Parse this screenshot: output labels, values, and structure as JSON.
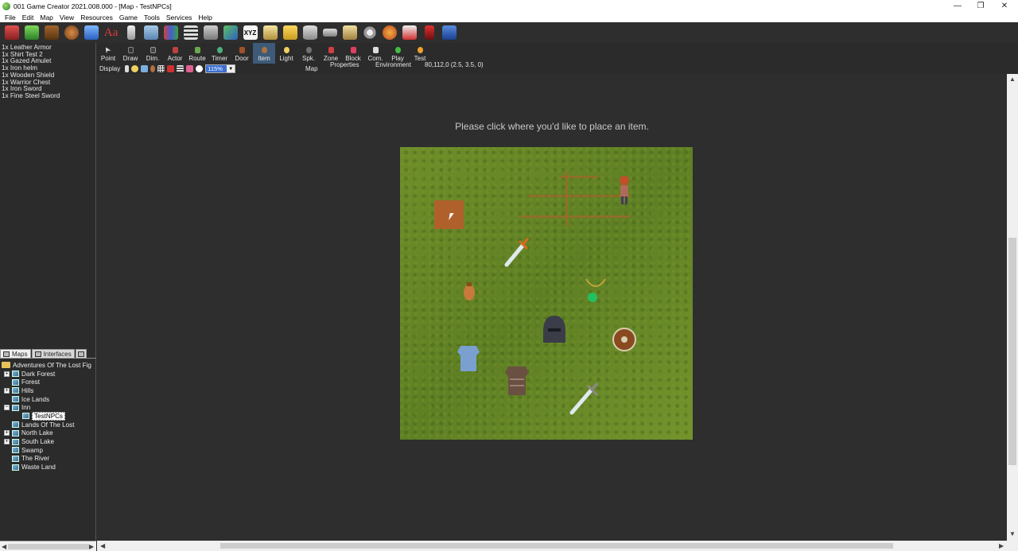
{
  "window": {
    "title": "001 Game Creator 2021.008.000 - [Map - TestNPCs]",
    "controls": [
      "—",
      "❐",
      "✕"
    ]
  },
  "menu": [
    "File",
    "Edit",
    "Map",
    "View",
    "Resources",
    "Game",
    "Tools",
    "Services",
    "Help"
  ],
  "toolbar_icons": [
    "character-icon",
    "tree-icon",
    "door-icon",
    "bag-icon",
    "music-icon",
    "font-icon",
    "figure-icon",
    "book-icon",
    "group-icon",
    "list-icon",
    "robot-icon",
    "chart-icon",
    "xyz-icon",
    "window-icon",
    "folder-icon",
    "database-icon",
    "controller-icon",
    "keyboard-icon",
    "gear-icon",
    "wrench-icon",
    "video-icon",
    "film-icon",
    "save-icon"
  ],
  "inventory": [
    "1x Leather Armor",
    "1x Shirt Test 2",
    "1x Gazed Amulet",
    "1x Iron helm",
    "1x Wooden Shield",
    "1x Warrior Chest",
    "1x Iron Sword",
    "1x Fine Steel Sword"
  ],
  "panel_tabs": [
    {
      "label": "Maps"
    },
    {
      "label": "Interfaces"
    }
  ],
  "tree": {
    "root": "Adventures Of The Lost Fig",
    "items": [
      {
        "label": "Dark Forest",
        "expandable": true
      },
      {
        "label": "Forest",
        "expandable": false
      },
      {
        "label": "Hills",
        "expandable": true
      },
      {
        "label": "Ice Lands",
        "expandable": false
      },
      {
        "label": "Inn",
        "expandable": true,
        "expanded": true
      },
      {
        "label": "TestNPCs",
        "child": true,
        "selected": true
      },
      {
        "label": "Lands Of The Lost",
        "expandable": false
      },
      {
        "label": "North Lake",
        "expandable": true
      },
      {
        "label": "South Lake",
        "expandable": true
      },
      {
        "label": "Swamp",
        "expandable": false
      },
      {
        "label": "The River",
        "expandable": false
      },
      {
        "label": "Waste Land",
        "expandable": false
      }
    ]
  },
  "edit_tools": [
    {
      "label": "Point",
      "color": "#dddddd"
    },
    {
      "label": "Draw",
      "color": "#333333"
    },
    {
      "label": "Dim.",
      "color": "#444444"
    },
    {
      "label": "Actor",
      "color": "#c04040"
    },
    {
      "label": "Route",
      "color": "#6aa84f"
    },
    {
      "label": "Timer",
      "color": "#4caf7a"
    },
    {
      "label": "Door",
      "color": "#a0522d"
    },
    {
      "label": "Item",
      "color": "#b07040",
      "active": true
    },
    {
      "label": "Light",
      "color": "#f0d060"
    },
    {
      "label": "Spk.",
      "color": "#707070"
    },
    {
      "label": "Zone",
      "color": "#d04040"
    },
    {
      "label": "Block",
      "color": "#e04060"
    },
    {
      "label": "Com.",
      "color": "#dddddd"
    },
    {
      "label": "Play",
      "color": "#40c040"
    },
    {
      "label": "Test",
      "color": "#f0a030"
    }
  ],
  "display": {
    "label": "Display",
    "zoom": "115%",
    "tabs": [
      "Map",
      "Properties",
      "Environment"
    ],
    "coords": "80,112,0 (2.5, 3.5, 0)"
  },
  "canvas": {
    "instruction": "Please click where you'd like to place an item."
  },
  "map_items": [
    "sword-icon",
    "amulet-icon",
    "bag-icon",
    "helmet-icon",
    "shield-icon",
    "armor-icon",
    "chest-armor-icon",
    "sword-icon",
    "npc-icon"
  ]
}
